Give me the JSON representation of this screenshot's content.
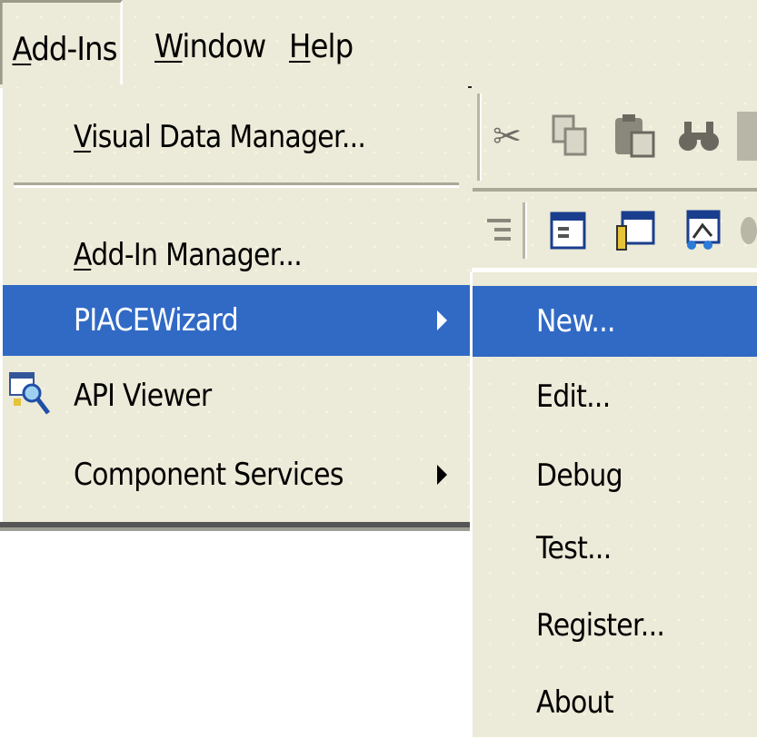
{
  "menubar": {
    "items": [
      {
        "label": "Add-Ins",
        "mnemonic": "A",
        "open": true
      },
      {
        "label": "Window",
        "mnemonic": "W"
      },
      {
        "label": "Help",
        "mnemonic": "H"
      }
    ]
  },
  "toolbar": {
    "icons": [
      "cut-icon",
      "copy-icon",
      "paste-icon",
      "find-icon",
      "indent-icon",
      "form-icon",
      "properties-icon",
      "object-browser-icon"
    ]
  },
  "addins_menu": {
    "items": [
      {
        "label": "Visual Data Manager...",
        "mnemonic": "V"
      },
      {
        "label": "Add-In Manager...",
        "mnemonic": "A"
      },
      {
        "label": "PIACEWizard",
        "highlighted": true,
        "has_submenu": true
      },
      {
        "label": "API Viewer",
        "icon": "api-viewer-icon"
      },
      {
        "label": "Component Services",
        "has_submenu": true
      }
    ]
  },
  "piacewizard_submenu": {
    "items": [
      {
        "label": "New...",
        "highlighted": true
      },
      {
        "label": "Edit..."
      },
      {
        "label": "Debug"
      },
      {
        "label": "Test..."
      },
      {
        "label": "Register..."
      },
      {
        "label": "About"
      }
    ]
  },
  "colors": {
    "menu_background": "#ecead8",
    "highlight": "#316ac5",
    "highlight_text": "#ffffff"
  }
}
